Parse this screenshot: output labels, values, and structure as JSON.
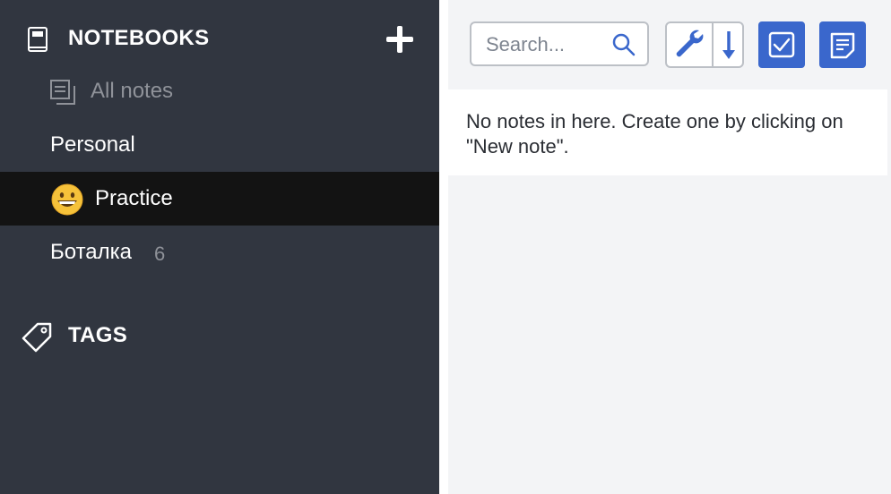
{
  "sidebar": {
    "notebooks_title": "NOTEBOOKS",
    "all_notes_label": "All notes",
    "notebooks": [
      {
        "label": "Personal",
        "count": ""
      },
      {
        "label": "Practice",
        "count": "",
        "emoji": "grinning-face"
      },
      {
        "label": "Боталка",
        "count": "6"
      }
    ],
    "tags_title": "TAGS"
  },
  "toolbar": {
    "search_placeholder": "Search..."
  },
  "note_list": {
    "empty_message": "No notes in here. Create one by clicking on \"New note\"."
  },
  "colors": {
    "sidebar_bg": "#313640",
    "selected_bg": "#131313",
    "accent_blue": "#3a67cc",
    "muted_text": "#8f9299"
  }
}
